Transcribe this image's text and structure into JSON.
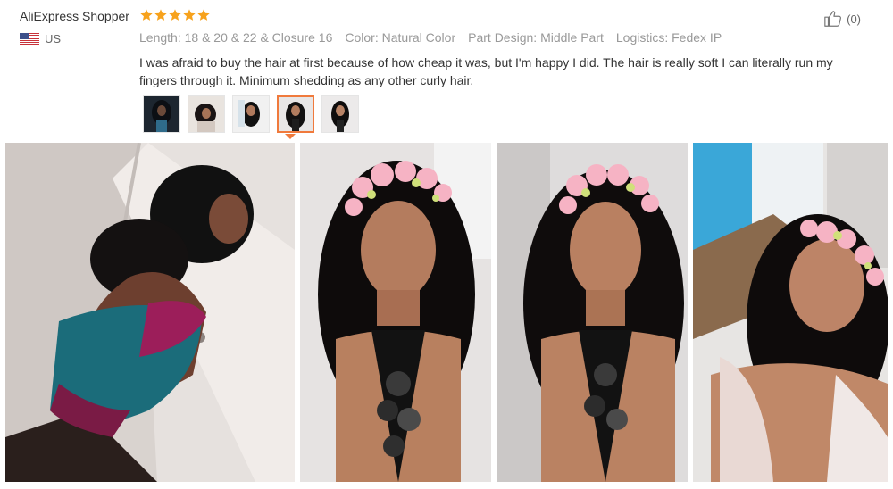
{
  "review": {
    "reviewer_name": "AliExpress Shopper",
    "rating": 5,
    "country_code": "US",
    "helpful_count": "(0)",
    "attributes": [
      {
        "key": "Length:",
        "value": "18 & 20 & 22 & Closure 16"
      },
      {
        "key": "Color:",
        "value": "Natural Color"
      },
      {
        "key": "Part Design:",
        "value": "Middle Part"
      },
      {
        "key": "Logistics:",
        "value": "Fedex IP"
      }
    ],
    "text": "I was afraid to buy the hair at first because of how cheap it was, but I'm happy I did. The hair is really soft I can literally run my fingers through it. Minimum shedding as any other curly hair.",
    "thumbnails_count": 5,
    "active_thumbnail_index": 3,
    "photos_count": 4
  },
  "colors": {
    "star": "#f7a21c",
    "active_border": "#f07a3c",
    "muted_text": "#999999"
  },
  "icons": {
    "rating": "star-icon",
    "flag": "us-flag-icon",
    "helpful": "thumbs-up-icon"
  }
}
